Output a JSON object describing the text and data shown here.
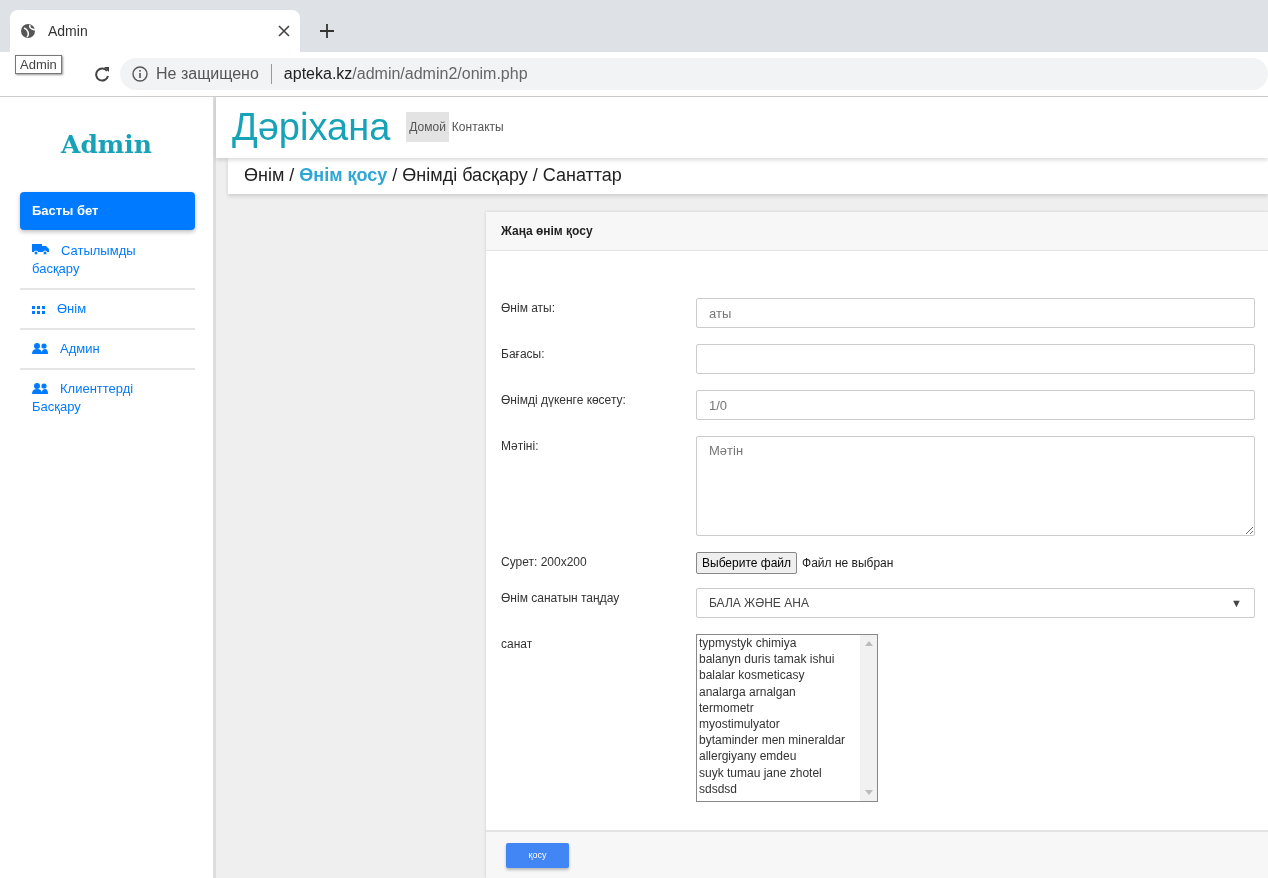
{
  "browser": {
    "tab_title": "Admin",
    "tooltip": "Admin",
    "security_label": "Не защищено",
    "url_host": "apteka.kz",
    "url_path": "/admin/admin2/onim.php"
  },
  "sidebar": {
    "logo": "Admin",
    "items": [
      {
        "label": "Басты бет",
        "selected": true
      },
      {
        "label": "Сатылымды басқару",
        "selected": false
      },
      {
        "label": "Өнім",
        "selected": false
      },
      {
        "label": "Админ",
        "selected": false
      },
      {
        "label": "Клиенттерді Басқару",
        "selected": false
      }
    ]
  },
  "header": {
    "brand": "Дәріхана",
    "nav": [
      {
        "label": "Домой",
        "selected": true
      },
      {
        "label": "Контакты",
        "selected": false
      }
    ]
  },
  "breadcrumb": {
    "items": [
      {
        "label": "Өнім",
        "selected": false
      },
      {
        "label": "Өнім қосу",
        "selected": true
      },
      {
        "label": "Өнімді басқару",
        "selected": false
      },
      {
        "label": "Санаттар",
        "selected": false
      }
    ],
    "separators": [
      "/",
      "/",
      "/"
    ]
  },
  "form": {
    "title": "Жаңа өнім қосу",
    "fields": [
      {
        "kind": "text",
        "label": "Өнім аты:",
        "placeholder": "аты"
      },
      {
        "kind": "text",
        "label": "Бағасы:"
      },
      {
        "kind": "text",
        "label": "Өнімді дүкенге көсету:",
        "placeholder": "1/0"
      },
      {
        "kind": "textarea",
        "label": "Мәтіні:",
        "placeholder": "Мәтін"
      },
      {
        "kind": "file",
        "label": "Сурет: 200x200",
        "button": "Выберите файл",
        "status": "Файл не выбран"
      },
      {
        "kind": "select",
        "label": "Өнім санатын таңдау",
        "value": "БАЛА ЖӘНЕ АНА",
        "arrow": "▼"
      },
      {
        "kind": "listbox",
        "label": "санат",
        "options": [
          {
            "label": "typmystyk chimiya",
            "selected": false
          },
          {
            "label": "balanyn duris tamak ishui",
            "selected": false
          },
          {
            "label": "balalar kosmeticasy",
            "selected": false
          },
          {
            "label": "analarga arnalgan",
            "selected": false
          },
          {
            "label": "termometr",
            "selected": false
          },
          {
            "label": "myostimulyator",
            "selected": false
          },
          {
            "label": "bytaminder men mineraldar",
            "selected": false
          },
          {
            "label": "allergiyany emdeu",
            "selected": false
          },
          {
            "label": "suyk tumau jane zhotel",
            "selected": false
          },
          {
            "label": "sdsdsd",
            "selected": false
          }
        ]
      }
    ],
    "submit": "қосу"
  }
}
